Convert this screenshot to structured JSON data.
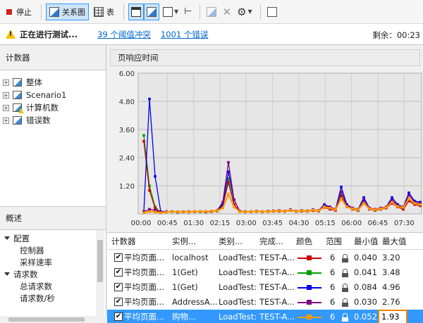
{
  "toolbar": {
    "stop_label": "停止",
    "graph_label": "关系图",
    "table_label": "表"
  },
  "status": {
    "running_text": "正在进行测试...",
    "threshold_link": "39 个阈值冲突",
    "error_link": "1001 个错误",
    "remaining": "剩余：00:23"
  },
  "counters_panel": {
    "title": "计数器",
    "items": [
      {
        "label": "整体",
        "icon": "graph-icon"
      },
      {
        "label": "Scenario1",
        "icon": "graph-icon"
      },
      {
        "label": "计算机数",
        "icon": "graph-warning-icon"
      },
      {
        "label": "错误数",
        "icon": "graph-icon"
      }
    ]
  },
  "overview_panel": {
    "title": "概述",
    "items": [
      {
        "label": "配置",
        "level": 0,
        "expanded": true
      },
      {
        "label": "控制器",
        "level": 1
      },
      {
        "label": "采样速率",
        "level": 1
      },
      {
        "label": "请求数",
        "level": 0,
        "expanded": true
      },
      {
        "label": "总请求数",
        "level": 1
      },
      {
        "label": "请求数/秒",
        "level": 1
      }
    ]
  },
  "chart": {
    "title": "页响应时间"
  },
  "chart_data": {
    "type": "line",
    "ylim": [
      0,
      6.0
    ],
    "yticks": [
      "6.00",
      "4.80",
      "3.60",
      "2.40",
      "1.20"
    ],
    "xticks": [
      "00:00",
      "00:45",
      "01:30",
      "02:15",
      "03:00",
      "03:45",
      "04:30",
      "05:15",
      "06:00",
      "06:45",
      "07:30"
    ],
    "grid": true,
    "series": [
      {
        "color": "#00a000",
        "values": [
          3.35,
          1.2,
          0.3,
          0.05,
          0.08,
          0.09,
          0.07,
          0.09,
          0.08,
          0.09,
          0.09,
          0.08,
          0.1,
          0.12,
          0.3,
          1.5,
          0.4,
          0.1,
          0.08,
          0.09,
          0.1,
          0.09,
          0.1,
          0.11,
          0.12,
          0.1,
          0.15,
          0.1,
          0.12,
          0.11,
          0.14,
          0.12,
          0.3,
          0.2,
          0.15,
          0.8,
          0.3,
          0.2,
          0.15,
          0.5,
          0.2,
          0.15,
          0.2,
          0.25,
          0.5,
          0.3,
          0.2,
          0.6,
          0.4,
          0.35
        ]
      },
      {
        "color": "#cc0000",
        "values": [
          3.1,
          1.0,
          0.25,
          0.05,
          0.08,
          0.1,
          0.07,
          0.09,
          0.08,
          0.09,
          0.1,
          0.08,
          0.1,
          0.13,
          0.35,
          1.35,
          0.4,
          0.1,
          0.08,
          0.09,
          0.1,
          0.09,
          0.1,
          0.11,
          0.12,
          0.1,
          0.15,
          0.1,
          0.12,
          0.11,
          0.14,
          0.12,
          0.28,
          0.2,
          0.15,
          0.75,
          0.3,
          0.2,
          0.15,
          0.45,
          0.2,
          0.15,
          0.2,
          0.25,
          0.45,
          0.3,
          0.2,
          0.55,
          0.4,
          0.35
        ]
      },
      {
        "color": "#0000ee",
        "values": [
          0.1,
          4.9,
          1.6,
          0.1,
          0.1,
          0.1,
          0.09,
          0.1,
          0.1,
          0.1,
          0.11,
          0.1,
          0.12,
          0.15,
          0.4,
          1.8,
          0.6,
          0.12,
          0.1,
          0.1,
          0.12,
          0.1,
          0.12,
          0.13,
          0.15,
          0.12,
          0.18,
          0.12,
          0.15,
          0.13,
          0.18,
          0.15,
          0.4,
          0.3,
          0.2,
          1.15,
          0.4,
          0.25,
          0.2,
          0.7,
          0.25,
          0.2,
          0.25,
          0.3,
          0.7,
          0.4,
          0.3,
          0.9,
          0.55,
          0.5
        ]
      },
      {
        "color": "#800080",
        "values": [
          0.1,
          0.2,
          0.15,
          0.08,
          0.1,
          0.1,
          0.09,
          0.1,
          0.1,
          0.1,
          0.11,
          0.1,
          0.12,
          0.15,
          0.5,
          2.2,
          0.6,
          0.12,
          0.1,
          0.1,
          0.12,
          0.1,
          0.12,
          0.13,
          0.15,
          0.12,
          0.18,
          0.12,
          0.15,
          0.13,
          0.18,
          0.15,
          0.35,
          0.3,
          0.2,
          0.95,
          0.35,
          0.25,
          0.2,
          0.6,
          0.25,
          0.2,
          0.25,
          0.3,
          0.6,
          0.35,
          0.3,
          0.8,
          0.5,
          0.45
        ]
      },
      {
        "color": "#ff9900",
        "values": [
          0.05,
          0.1,
          0.08,
          0.05,
          0.08,
          0.1,
          0.09,
          0.1,
          0.09,
          0.1,
          0.11,
          0.1,
          0.12,
          0.14,
          0.25,
          0.85,
          0.3,
          0.1,
          0.09,
          0.1,
          0.11,
          0.1,
          0.11,
          0.12,
          0.14,
          0.11,
          0.16,
          0.11,
          0.14,
          0.12,
          0.16,
          0.14,
          0.3,
          0.25,
          0.18,
          0.65,
          0.3,
          0.22,
          0.18,
          0.45,
          0.22,
          0.18,
          0.22,
          0.28,
          0.5,
          0.32,
          0.28,
          0.65,
          0.45,
          0.4
        ]
      }
    ]
  },
  "table": {
    "headers": [
      "计数器",
      "实例...",
      "类别...",
      "完成...",
      "颜色",
      "范围",
      "最小值",
      "最大值"
    ],
    "rows": [
      {
        "counter": "平均页面...",
        "instance": "localhost",
        "category": "LoadTest:",
        "computer": "TEST-A...",
        "color": "#cc0000",
        "range": "6",
        "min": "0.040",
        "max": "3.20"
      },
      {
        "counter": "平均页面...",
        "instance": "1(Get)",
        "category": "LoadTest:",
        "computer": "TEST-A...",
        "color": "#00a000",
        "range": "6",
        "min": "0.041",
        "max": "3.48"
      },
      {
        "counter": "平均页面...",
        "instance": "1(Get)",
        "category": "LoadTest:",
        "computer": "TEST-A...",
        "color": "#0000ee",
        "range": "6",
        "min": "0.084",
        "max": "4.96"
      },
      {
        "counter": "平均页面...",
        "instance": "AddressA...",
        "category": "LoadTest:",
        "computer": "TEST-A...",
        "color": "#800080",
        "range": "6",
        "min": "0.030",
        "max": "2.76"
      },
      {
        "counter": "平均页面...",
        "instance": "购物...",
        "category": "LoadTest:",
        "computer": "TEST-A...",
        "color": "#ff9900",
        "range": "6",
        "min": "0.052",
        "max": "1.93"
      }
    ]
  }
}
